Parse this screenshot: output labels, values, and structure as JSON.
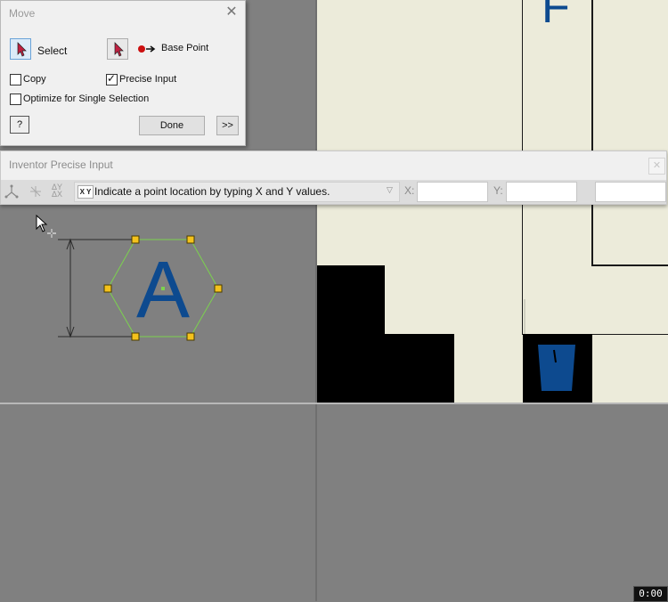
{
  "move_dialog": {
    "title": "Move",
    "select_label": "Select",
    "base_point_label": "Base Point",
    "copy_label": "Copy",
    "copy_checked": false,
    "precise_input_label": "Precise Input",
    "precise_input_checked": true,
    "optimize_label": "Optimize for Single Selection",
    "optimize_checked": false,
    "done_label": "Done",
    "more_label": ">>",
    "help_label": "?"
  },
  "precise_input": {
    "title": "Inventor Precise Input",
    "mode_badge": "X Y",
    "prompt": "Indicate a point location by typing X and Y values.",
    "x_label": "X:",
    "y_label": "Y:",
    "x_value": "",
    "y_value": "",
    "z_value": ""
  },
  "sketch": {
    "letter": "A",
    "top_letter": "F"
  },
  "timer": "0:00",
  "colors": {
    "sheet": "#ecebda",
    "hexagon": "#7cd24e",
    "grip": "#f4c21c",
    "letter": "#0d4a8f"
  }
}
